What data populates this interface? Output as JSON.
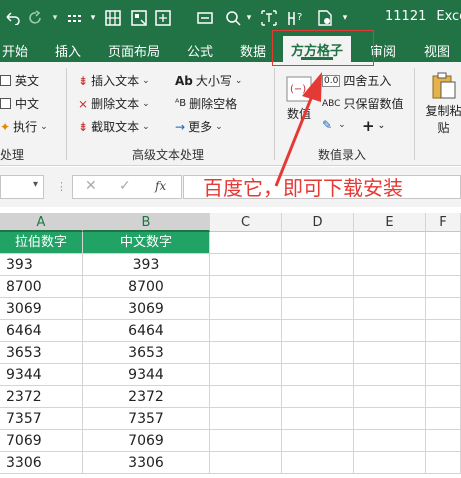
{
  "titlebar": {
    "icons": [
      "undo-icon",
      "redo-icon",
      "grid-icon",
      "table-icon",
      "tools-icon",
      "search-cell-icon",
      "text-icon",
      "help-icon",
      "doc-icon"
    ],
    "file_name": "11121",
    "app_name": "Exce"
  },
  "tabs": [
    {
      "label": "开始"
    },
    {
      "label": "插入"
    },
    {
      "label": "页面布局"
    },
    {
      "label": "公式"
    },
    {
      "label": "数据"
    },
    {
      "label": "方方格子",
      "active": true
    },
    {
      "label": "审阅"
    },
    {
      "label": "视图"
    }
  ],
  "ribbon": {
    "left_group": {
      "english": "英文",
      "chinese": "中文",
      "execute": "执行",
      "label": "处理"
    },
    "advanced_text": {
      "insert_text": "插入文本",
      "delete_text": "删除文本",
      "cut_text": "截取文本",
      "case": "大小写",
      "delete_spaces": "删除空格",
      "more": "更多",
      "label": "高级文本处理"
    },
    "numeric": {
      "numeric_btn": "数值",
      "round": "四舍五入",
      "keep_numbers": "只保留数值",
      "plus": "+",
      "label": "数值录入"
    },
    "copy_paste": {
      "line1": "复制粘",
      "line2": "贴"
    }
  },
  "formula_bar": {
    "cancel": "✕",
    "confirm": "✓",
    "fx": "fx"
  },
  "annotation": {
    "text": "百度它，即可下载安装"
  },
  "grid": {
    "columns": [
      "A",
      "B",
      "C",
      "D",
      "E",
      "F"
    ],
    "header_row": [
      "拉伯数字",
      "中文数字"
    ],
    "rows": [
      [
        "393",
        "393"
      ],
      [
        "8700",
        "8700"
      ],
      [
        "3069",
        "3069"
      ],
      [
        "6464",
        "6464"
      ],
      [
        "3653",
        "3653"
      ],
      [
        "9344",
        "9344"
      ],
      [
        "2372",
        "2372"
      ],
      [
        "7357",
        "7357"
      ],
      [
        "7069",
        "7069"
      ],
      [
        "3306",
        "3306"
      ]
    ]
  },
  "colors": {
    "excel_green": "#217346",
    "header_green": "#21a366",
    "annotation_red": "#e53935"
  }
}
